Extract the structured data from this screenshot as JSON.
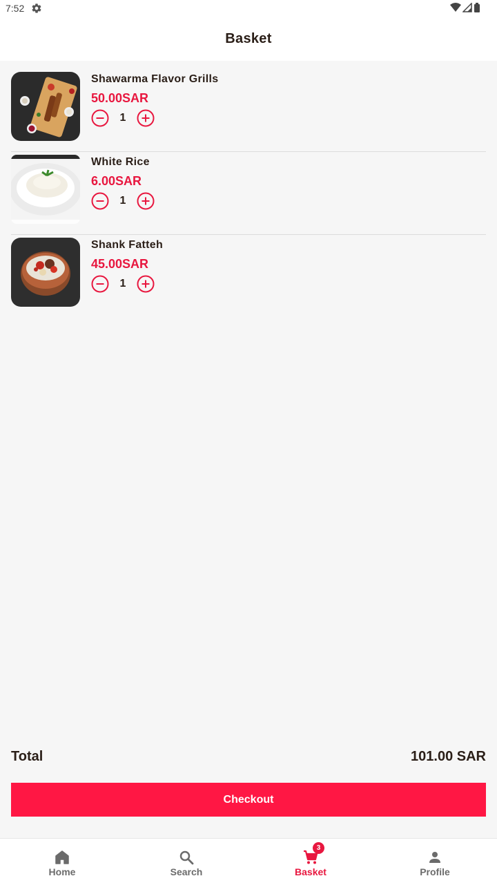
{
  "status_bar": {
    "time": "7:52"
  },
  "app_bar": {
    "title": "Basket"
  },
  "items": [
    {
      "name": "Shawarma Flavor Grills",
      "price": "50.00SAR",
      "quantity": "1"
    },
    {
      "name": "White Rice",
      "price": "6.00SAR",
      "quantity": "1"
    },
    {
      "name": "Shank Fatteh",
      "price": "45.00SAR",
      "quantity": "1"
    }
  ],
  "summary": {
    "total_label": "Total",
    "total_value": "101.00 SAR"
  },
  "checkout": {
    "label": "Checkout"
  },
  "bottom_nav": {
    "items": [
      {
        "label": "Home",
        "icon": "home-icon"
      },
      {
        "label": "Search",
        "icon": "search-icon"
      },
      {
        "label": "Basket",
        "icon": "cart-icon",
        "badge": "3",
        "active": true
      },
      {
        "label": "Profile",
        "icon": "person-icon"
      }
    ]
  },
  "colors": {
    "accent": "#e8173f",
    "button": "#ff1744",
    "background": "#f6f6f6"
  }
}
